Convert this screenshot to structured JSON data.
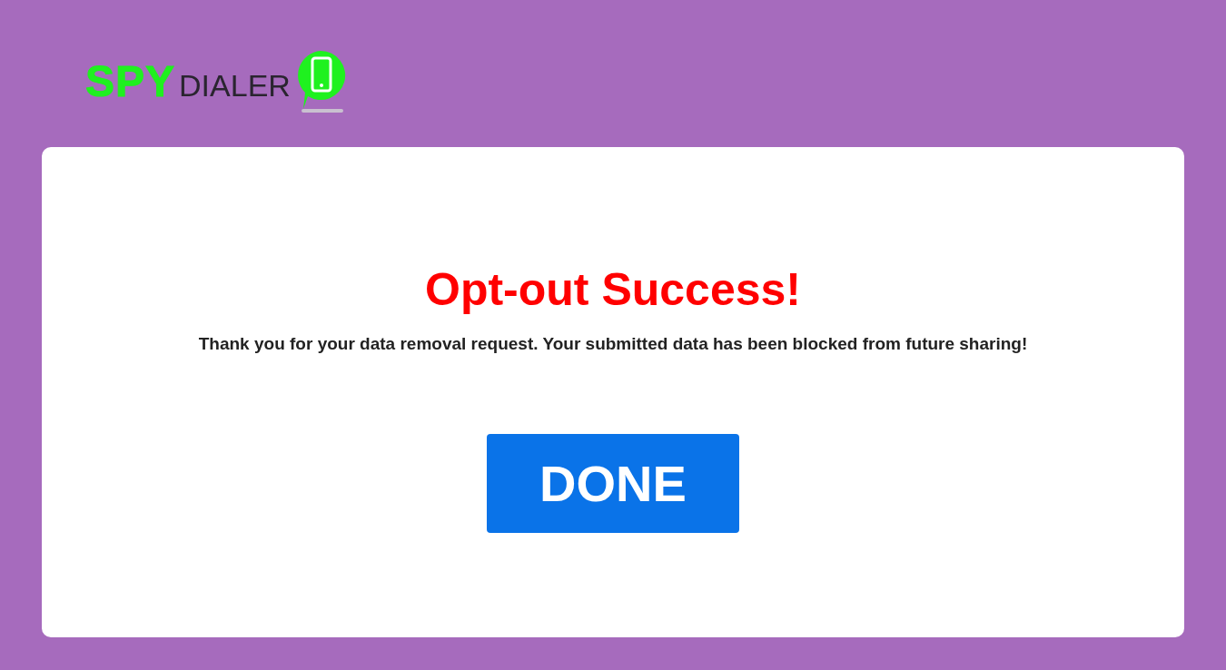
{
  "logo": {
    "part_1": "SPY",
    "part_2": "DIALER"
  },
  "card": {
    "title": "Opt-out Success!",
    "message": "Thank you for your data removal request. Your submitted data has been blocked from future sharing!",
    "button": "DONE"
  }
}
